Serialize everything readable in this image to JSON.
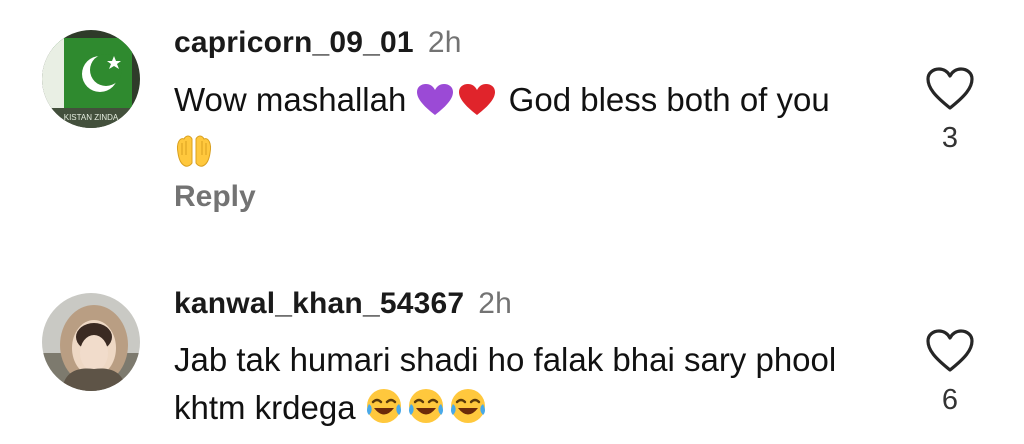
{
  "comments": [
    {
      "username": "capricorn_09_01",
      "time": "2h",
      "text_before": "Wow mashallah ",
      "emojis_mid": [
        "purple-heart",
        "red-heart"
      ],
      "text_after": " God bless both of you ",
      "emojis_end": [
        "palms-up-together"
      ],
      "likes": "3",
      "reply_label": "Reply",
      "avatar_text": "KISTAN ZINDA"
    },
    {
      "username": "kanwal_khan_54367",
      "time": "2h",
      "text": "Jab tak humari shadi ho falak bhai sary phool khtm krdega ",
      "emojis_end": [
        "face-with-tears-of-joy",
        "face-with-tears-of-joy",
        "face-with-tears-of-joy"
      ],
      "likes": "6"
    }
  ],
  "colors": {
    "secondary_text": "#737373",
    "primary_text": "#111111",
    "purple_heart": "#9b4ad6",
    "red_heart": "#e0242b",
    "emoji_yellow": "#ffc83d"
  }
}
